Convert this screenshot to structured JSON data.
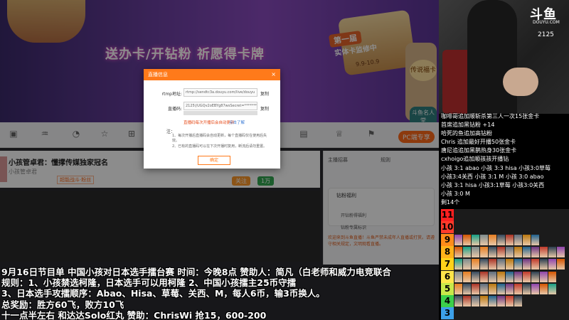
{
  "banner": {
    "title": "送办卡/开钻粉 祈愿得卡牌",
    "chip": "第一届",
    "subtitle": "实体卡监修中",
    "date": "9.9-10.9",
    "badge1": "传说福卡",
    "badge2": "斗鱼名人堂"
  },
  "toolbar": {
    "pc_exclusive": "PC端专享"
  },
  "room": {
    "title": "小孩管卓君：懂撑传媒独家冠名",
    "sub": "小孩管卓君",
    "tag": "超能战斗·粉丝",
    "follow": "关注",
    "count": "1万"
  },
  "web_right": {
    "tab1": "主播招募",
    "tab2": "规则",
    "card_title": "钻粉福利",
    "item1": "开钻粉得福利",
    "item2": "钻粉专属标识",
    "notice": "欢迎来到斗鱼直播！斗鱼严禁未成年人直播或打赏。请遵守相关规定，文明观看直播。"
  },
  "modal": {
    "title": "直播信息",
    "close": "×",
    "rtmp_label": "rtmp地址:",
    "rtmp_value": "rtmp://sendtc3a.douyu.com/live/douyu",
    "code_label": "直播码:",
    "code_value": "2125\\/UGQv2oEBYg87wsSecret=**********",
    "copy": "复制",
    "warn": "直播码每次开播后会自动更新",
    "warn_link": "点击了解",
    "note_title": "注：",
    "note1": "1、每次开播后直播码会自动更新，每个直播码仅在使用后失效。",
    "note2": "2、已有的直播码可以在下次开播时复用，断流后请勿重置。",
    "ok": "确定"
  },
  "overlay": {
    "line1": "9月16日节目单  中国小孩对日本选手擂台赛 时间：今晚8点  赞助人：简凡（白老师和威力电竞联合",
    "line2": "规则：1、小孩禁选柯隆，日本选手可以用柯隆  2、中国小孩擂主25币守擂",
    "line3": "3、日本选手攻擂顺序：Abao、Hisa、草莓、关西、M，每人6币，输3币换人。",
    "line4": "总奖励：胜方60飞，败方10飞",
    "line5": "十一点半左右 和达达Solo红丸 赞助：ChrisWi 抢15，600-200"
  },
  "brand": {
    "logo": "斗鱼",
    "logo_sub": "DOUYU.COM",
    "room_id": "2125"
  },
  "chat": [
    "咖啡哥追加顺斩杀第三人一次15张金卡",
    "首席追加黑钻粉   +14",
    "哈死的鱼追加高钻粉",
    "Chris 追加最好开播50张金卡",
    "唐尼追追加黑鹊热身30张金卡",
    "cxhoigo追加顺孩孩开播钻",
    "小孩 3:1 abao  小孩 3:3 hisa  小孩3:0草莓",
    "小孩3:4关西  小孩 3:1 M  小孩 3:0 abao",
    "小孩 3:1 hisa  小孩3:1草莓  小孩3:0关西",
    "小孩 3:0 M",
    "剩14个"
  ],
  "tiers": [
    {
      "label": "11",
      "color": "#ff2020",
      "chars": 0
    },
    {
      "label": "10",
      "color": "#ff3b2b",
      "chars": 0
    },
    {
      "label": "9",
      "color": "#ff8c1a",
      "chars": 10
    },
    {
      "label": "8",
      "color": "#ffb21a",
      "chars": 13
    },
    {
      "label": "7",
      "color": "#ffd21a",
      "chars": 13
    },
    {
      "label": "6",
      "color": "#ffe54a",
      "chars": 12
    },
    {
      "label": "5",
      "color": "#c8e84a",
      "chars": 12
    },
    {
      "label": "4",
      "color": "#3ccf4a",
      "chars": 8
    },
    {
      "label": "3",
      "color": "#3ca0e8",
      "chars": 0
    }
  ]
}
